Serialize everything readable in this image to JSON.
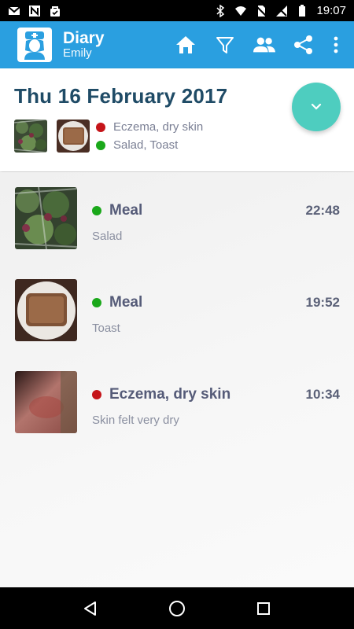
{
  "status_bar": {
    "time": "19:07",
    "icons_left": [
      "gmail-icon",
      "n-app-icon",
      "bag-icon"
    ],
    "icons_right": [
      "bluetooth-icon",
      "wifi-icon",
      "no-sim-icon",
      "signal-icon",
      "battery-icon"
    ]
  },
  "app_bar": {
    "title": "Diary",
    "subtitle": "Emily",
    "actions": [
      "home-icon",
      "filter-icon",
      "people-icon",
      "share-icon",
      "more-vert-icon"
    ],
    "color": "#2a9fe0"
  },
  "day": {
    "date": "Thu 16 February 2017",
    "tags": [
      {
        "label": "Eczema, dry skin",
        "status": "red"
      },
      {
        "label": "Salad, Toast",
        "status": "green"
      }
    ]
  },
  "entries": [
    {
      "title": "Meal",
      "time": "22:48",
      "description": "Salad",
      "status": "green",
      "thumb": "salad"
    },
    {
      "title": "Meal",
      "time": "19:52",
      "description": "Toast",
      "status": "green",
      "thumb": "toast"
    },
    {
      "title": "Eczema, dry skin",
      "time": "10:34",
      "description": "Skin felt very dry",
      "status": "red",
      "thumb": "skin"
    }
  ],
  "colors": {
    "accent": "#2a9fe0",
    "fab": "#4ecdbf",
    "status_red": "#c51419",
    "status_green": "#1aa81a",
    "date_text": "#1f4b66"
  }
}
